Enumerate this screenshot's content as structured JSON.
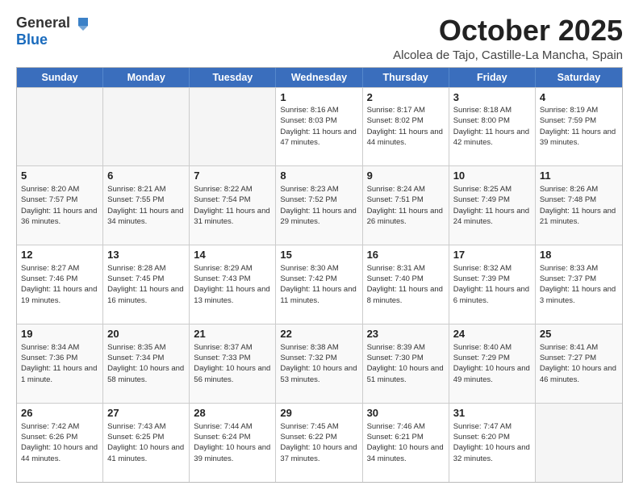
{
  "header": {
    "logo_general": "General",
    "logo_blue": "Blue",
    "month": "October 2025",
    "location": "Alcolea de Tajo, Castille-La Mancha, Spain"
  },
  "days_of_week": [
    "Sunday",
    "Monday",
    "Tuesday",
    "Wednesday",
    "Thursday",
    "Friday",
    "Saturday"
  ],
  "weeks": [
    [
      {
        "day": "",
        "info": ""
      },
      {
        "day": "",
        "info": ""
      },
      {
        "day": "",
        "info": ""
      },
      {
        "day": "1",
        "info": "Sunrise: 8:16 AM\nSunset: 8:03 PM\nDaylight: 11 hours and 47 minutes."
      },
      {
        "day": "2",
        "info": "Sunrise: 8:17 AM\nSunset: 8:02 PM\nDaylight: 11 hours and 44 minutes."
      },
      {
        "day": "3",
        "info": "Sunrise: 8:18 AM\nSunset: 8:00 PM\nDaylight: 11 hours and 42 minutes."
      },
      {
        "day": "4",
        "info": "Sunrise: 8:19 AM\nSunset: 7:59 PM\nDaylight: 11 hours and 39 minutes."
      }
    ],
    [
      {
        "day": "5",
        "info": "Sunrise: 8:20 AM\nSunset: 7:57 PM\nDaylight: 11 hours and 36 minutes."
      },
      {
        "day": "6",
        "info": "Sunrise: 8:21 AM\nSunset: 7:55 PM\nDaylight: 11 hours and 34 minutes."
      },
      {
        "day": "7",
        "info": "Sunrise: 8:22 AM\nSunset: 7:54 PM\nDaylight: 11 hours and 31 minutes."
      },
      {
        "day": "8",
        "info": "Sunrise: 8:23 AM\nSunset: 7:52 PM\nDaylight: 11 hours and 29 minutes."
      },
      {
        "day": "9",
        "info": "Sunrise: 8:24 AM\nSunset: 7:51 PM\nDaylight: 11 hours and 26 minutes."
      },
      {
        "day": "10",
        "info": "Sunrise: 8:25 AM\nSunset: 7:49 PM\nDaylight: 11 hours and 24 minutes."
      },
      {
        "day": "11",
        "info": "Sunrise: 8:26 AM\nSunset: 7:48 PM\nDaylight: 11 hours and 21 minutes."
      }
    ],
    [
      {
        "day": "12",
        "info": "Sunrise: 8:27 AM\nSunset: 7:46 PM\nDaylight: 11 hours and 19 minutes."
      },
      {
        "day": "13",
        "info": "Sunrise: 8:28 AM\nSunset: 7:45 PM\nDaylight: 11 hours and 16 minutes."
      },
      {
        "day": "14",
        "info": "Sunrise: 8:29 AM\nSunset: 7:43 PM\nDaylight: 11 hours and 13 minutes."
      },
      {
        "day": "15",
        "info": "Sunrise: 8:30 AM\nSunset: 7:42 PM\nDaylight: 11 hours and 11 minutes."
      },
      {
        "day": "16",
        "info": "Sunrise: 8:31 AM\nSunset: 7:40 PM\nDaylight: 11 hours and 8 minutes."
      },
      {
        "day": "17",
        "info": "Sunrise: 8:32 AM\nSunset: 7:39 PM\nDaylight: 11 hours and 6 minutes."
      },
      {
        "day": "18",
        "info": "Sunrise: 8:33 AM\nSunset: 7:37 PM\nDaylight: 11 hours and 3 minutes."
      }
    ],
    [
      {
        "day": "19",
        "info": "Sunrise: 8:34 AM\nSunset: 7:36 PM\nDaylight: 11 hours and 1 minute."
      },
      {
        "day": "20",
        "info": "Sunrise: 8:35 AM\nSunset: 7:34 PM\nDaylight: 10 hours and 58 minutes."
      },
      {
        "day": "21",
        "info": "Sunrise: 8:37 AM\nSunset: 7:33 PM\nDaylight: 10 hours and 56 minutes."
      },
      {
        "day": "22",
        "info": "Sunrise: 8:38 AM\nSunset: 7:32 PM\nDaylight: 10 hours and 53 minutes."
      },
      {
        "day": "23",
        "info": "Sunrise: 8:39 AM\nSunset: 7:30 PM\nDaylight: 10 hours and 51 minutes."
      },
      {
        "day": "24",
        "info": "Sunrise: 8:40 AM\nSunset: 7:29 PM\nDaylight: 10 hours and 49 minutes."
      },
      {
        "day": "25",
        "info": "Sunrise: 8:41 AM\nSunset: 7:27 PM\nDaylight: 10 hours and 46 minutes."
      }
    ],
    [
      {
        "day": "26",
        "info": "Sunrise: 7:42 AM\nSunset: 6:26 PM\nDaylight: 10 hours and 44 minutes."
      },
      {
        "day": "27",
        "info": "Sunrise: 7:43 AM\nSunset: 6:25 PM\nDaylight: 10 hours and 41 minutes."
      },
      {
        "day": "28",
        "info": "Sunrise: 7:44 AM\nSunset: 6:24 PM\nDaylight: 10 hours and 39 minutes."
      },
      {
        "day": "29",
        "info": "Sunrise: 7:45 AM\nSunset: 6:22 PM\nDaylight: 10 hours and 37 minutes."
      },
      {
        "day": "30",
        "info": "Sunrise: 7:46 AM\nSunset: 6:21 PM\nDaylight: 10 hours and 34 minutes."
      },
      {
        "day": "31",
        "info": "Sunrise: 7:47 AM\nSunset: 6:20 PM\nDaylight: 10 hours and 32 minutes."
      },
      {
        "day": "",
        "info": ""
      }
    ]
  ]
}
